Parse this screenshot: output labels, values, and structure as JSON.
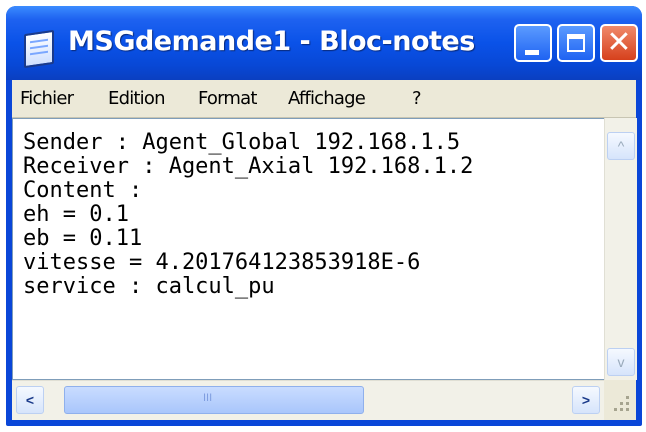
{
  "window": {
    "title": "MSGdemande1 - Bloc-notes"
  },
  "menu": {
    "items": [
      "Fichier",
      "Edition",
      "Format",
      "Affichage",
      "?"
    ]
  },
  "editor": {
    "lines": [
      "Sender : Agent_Global 192.168.1.5",
      "Receiver : Agent_Axial 192.168.1.2",
      "Content :",
      "eh = 0.1",
      "eb = 0.11",
      "vitesse = 4.201764123853918E-6",
      "service : calcul_pu"
    ]
  },
  "scrollbar": {
    "h_thumb_glyph": "III",
    "left_arrow": "<",
    "right_arrow": ">",
    "up_arrow": "^",
    "down_arrow": "v"
  },
  "colors": {
    "titlebar": "#0a52e8",
    "close_button": "#d6401c",
    "menubar": "#ece9d8"
  }
}
